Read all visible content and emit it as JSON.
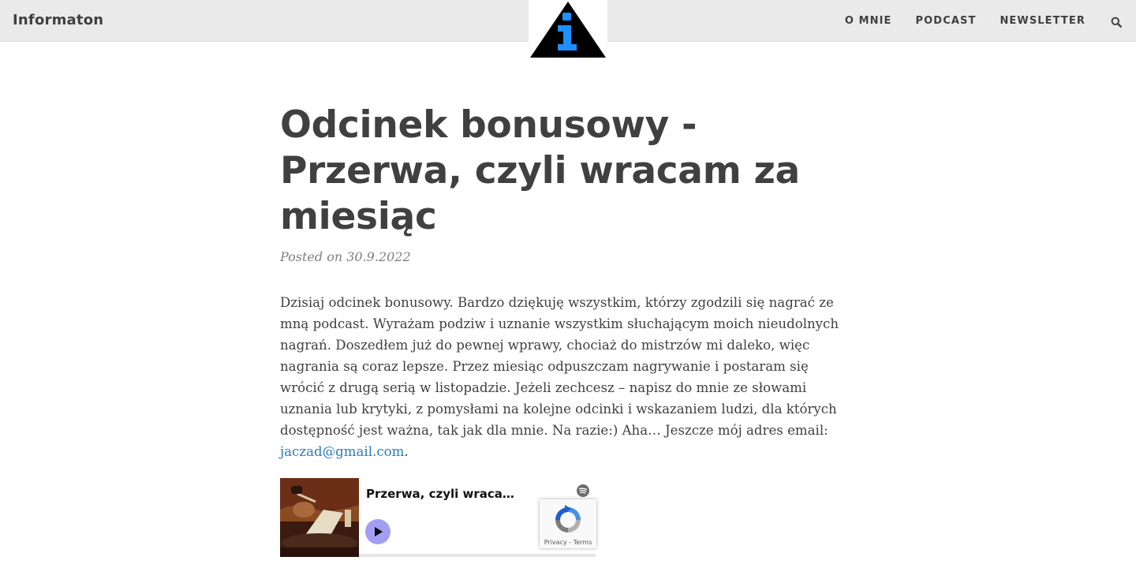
{
  "nav": {
    "brand": "Informaton",
    "links": [
      "O MNIE",
      "PODCAST",
      "NEWSLETTER"
    ],
    "search_icon": "search-icon",
    "logo_icon": "info-triangle-logo"
  },
  "post": {
    "title": "Odcinek bonusowy - Przerwa, czyli wracam za miesiąc",
    "meta": "Posted on 30.9.2022",
    "body_text": "Dzisiaj odcinek bonusowy. Bardzo dziękuję wszystkim, którzy zgodzili się nagrać ze mną podcast. Wyrażam podziw i uznanie wszystkim słuchającym moich nieudolnych nagrań. Doszedłem już do pewnej wprawy, chociaż do mistrzów mi daleko, więc nagrania są coraz lepsze. Przez miesiąc odpuszczam nagrywanie i postaram się wrócić z drugą serią w listopadzie. Jeżeli zechcesz – napisz do mnie ze słowami uznania lub krytyki, z pomysłami na kolejne odcinki i wskazaniem ludzi, dla których dostępność jest ważna, tak jak dla mnie. Na razie:) Aha… Jeszcze mój adres email: ",
    "email": "jaczad@gmail.com",
    "trailing": "."
  },
  "embed": {
    "title": "Przerwa, czyli wraca…",
    "play_icon": "play-icon",
    "brand_icon": "spotify-icon"
  },
  "recaptcha": {
    "privacy": "Privacy",
    "separator": " - ",
    "terms": "Terms"
  },
  "colors": {
    "navbar_bg": "#eaeaea",
    "text": "#404040",
    "link": "#2b7bbf",
    "logo_blue": "#1e90ff",
    "play_button": "#a39ef4"
  }
}
